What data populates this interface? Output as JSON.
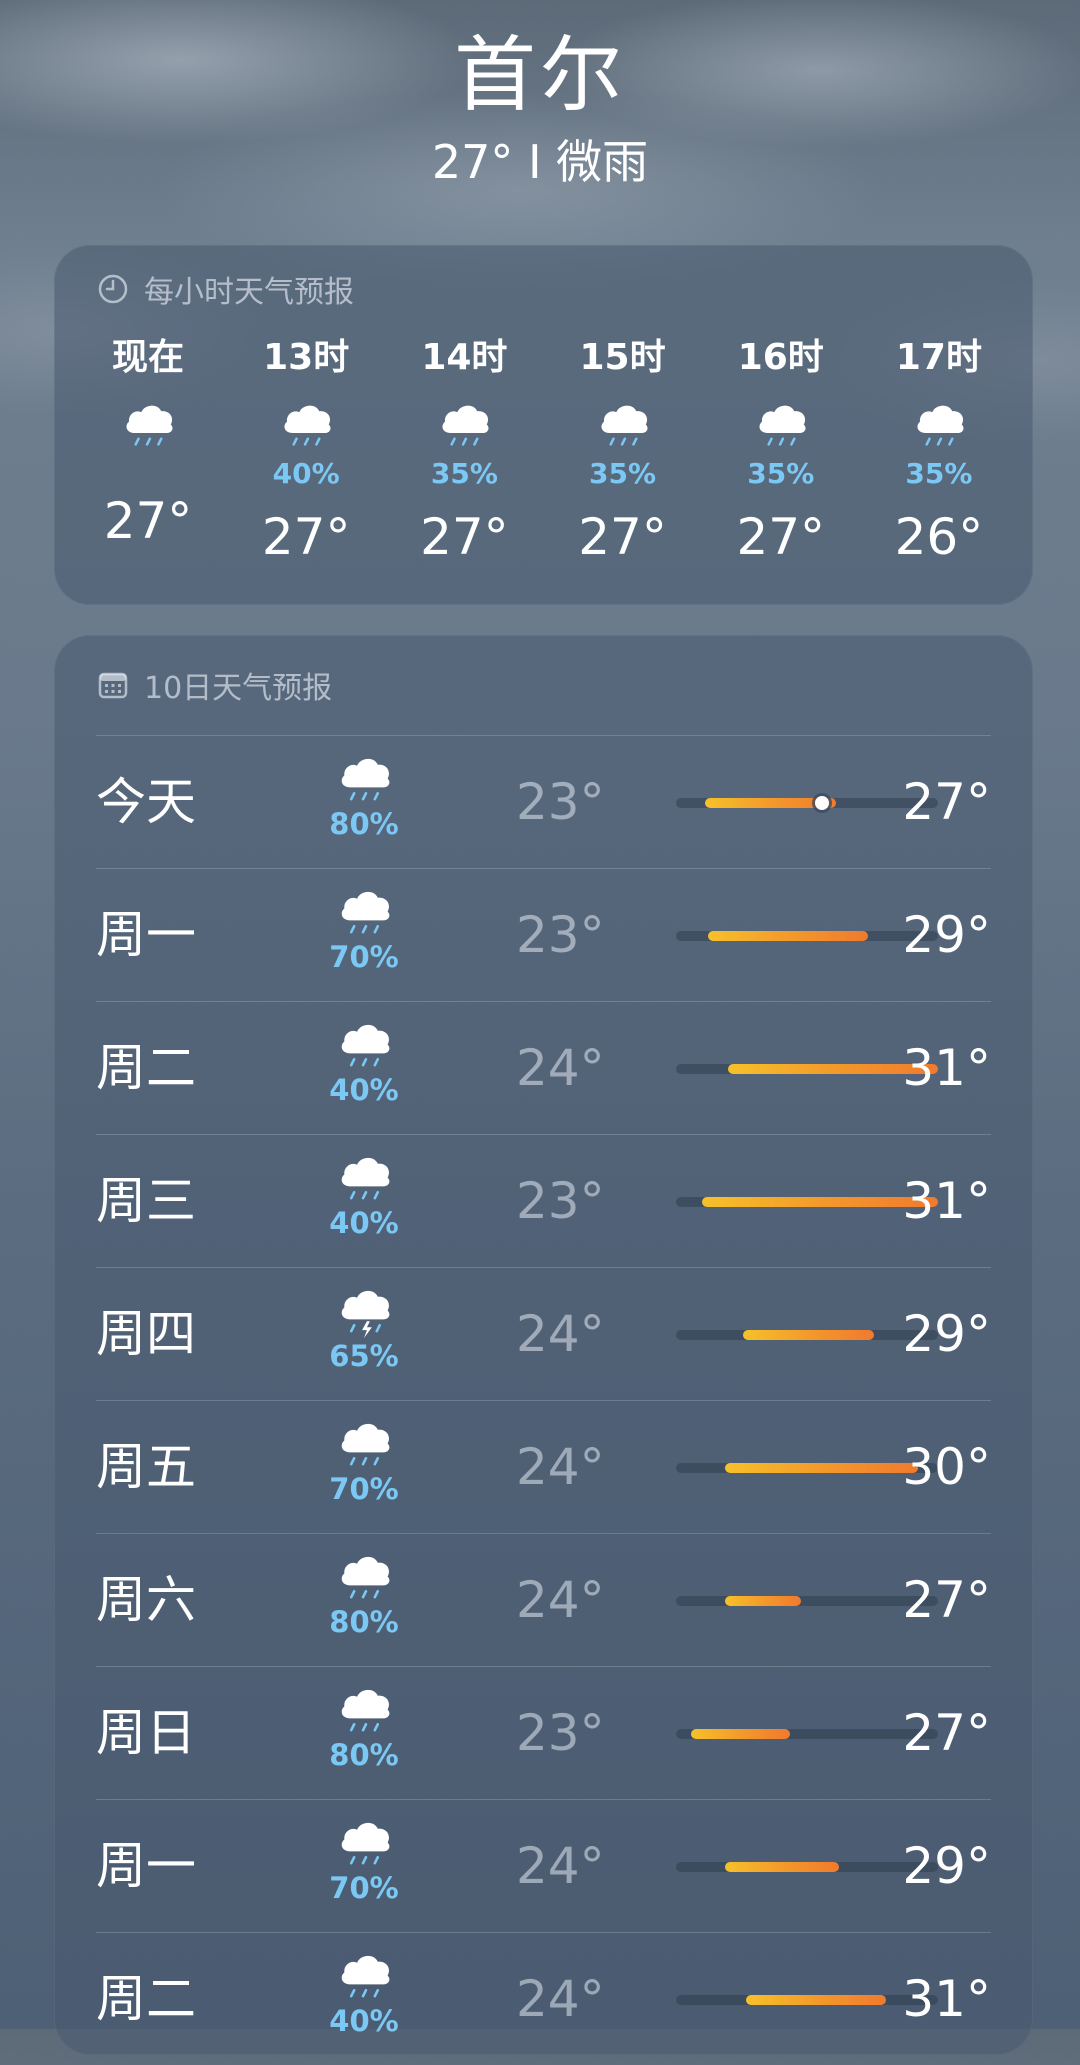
{
  "location": {
    "city": "首尔",
    "summary": "27° I 微雨"
  },
  "hourly": {
    "title": "每小时天气预报",
    "items": [
      {
        "label": "现在",
        "pop": "",
        "temp": "27°"
      },
      {
        "label": "13时",
        "pop": "40%",
        "temp": "27°"
      },
      {
        "label": "14时",
        "pop": "35%",
        "temp": "27°"
      },
      {
        "label": "15时",
        "pop": "35%",
        "temp": "27°"
      },
      {
        "label": "16时",
        "pop": "35%",
        "temp": "27°"
      },
      {
        "label": "17时",
        "pop": "35%",
        "temp": "26°"
      }
    ]
  },
  "daily": {
    "title": "10日天气预报",
    "temp_range": {
      "min": 22,
      "max": 31
    },
    "current_temp": 27,
    "items": [
      {
        "day": "今天",
        "icon": "rain-cloud-icon",
        "pop": "80%",
        "low": "23°",
        "high": "27°",
        "low_val": 23,
        "high_val": 27.5,
        "now": true
      },
      {
        "day": "周一",
        "icon": "rain-cloud-icon",
        "pop": "70%",
        "low": "23°",
        "high": "29°",
        "low_val": 23.1,
        "high_val": 28.6
      },
      {
        "day": "周二",
        "icon": "rain-cloud-icon",
        "pop": "40%",
        "low": "24°",
        "high": "31°",
        "low_val": 23.8,
        "high_val": 31
      },
      {
        "day": "周三",
        "icon": "rain-cloud-icon",
        "pop": "40%",
        "low": "23°",
        "high": "31°",
        "low_val": 22.9,
        "high_val": 31
      },
      {
        "day": "周四",
        "icon": "thunderstorm-icon",
        "pop": "65%",
        "low": "24°",
        "high": "29°",
        "low_val": 24.3,
        "high_val": 28.8
      },
      {
        "day": "周五",
        "icon": "rain-cloud-icon",
        "pop": "70%",
        "low": "24°",
        "high": "30°",
        "low_val": 23.7,
        "high_val": 30.3
      },
      {
        "day": "周六",
        "icon": "rain-cloud-icon",
        "pop": "80%",
        "low": "24°",
        "high": "27°",
        "low_val": 23.7,
        "high_val": 26.3
      },
      {
        "day": "周日",
        "icon": "rain-cloud-icon",
        "pop": "80%",
        "low": "23°",
        "high": "27°",
        "low_val": 22.5,
        "high_val": 25.9
      },
      {
        "day": "周一",
        "icon": "rain-cloud-icon",
        "pop": "70%",
        "low": "24°",
        "high": "29°",
        "low_val": 23.7,
        "high_val": 27.6
      },
      {
        "day": "周二",
        "icon": "rain-cloud-icon",
        "pop": "40%",
        "low": "24°",
        "high": "31°",
        "low_val": 24.4,
        "high_val": 29.2
      }
    ]
  },
  "colors": {
    "pop": "#7cc8f4",
    "bar_start": "#f6c12a",
    "bar_end": "#f07a2e"
  }
}
